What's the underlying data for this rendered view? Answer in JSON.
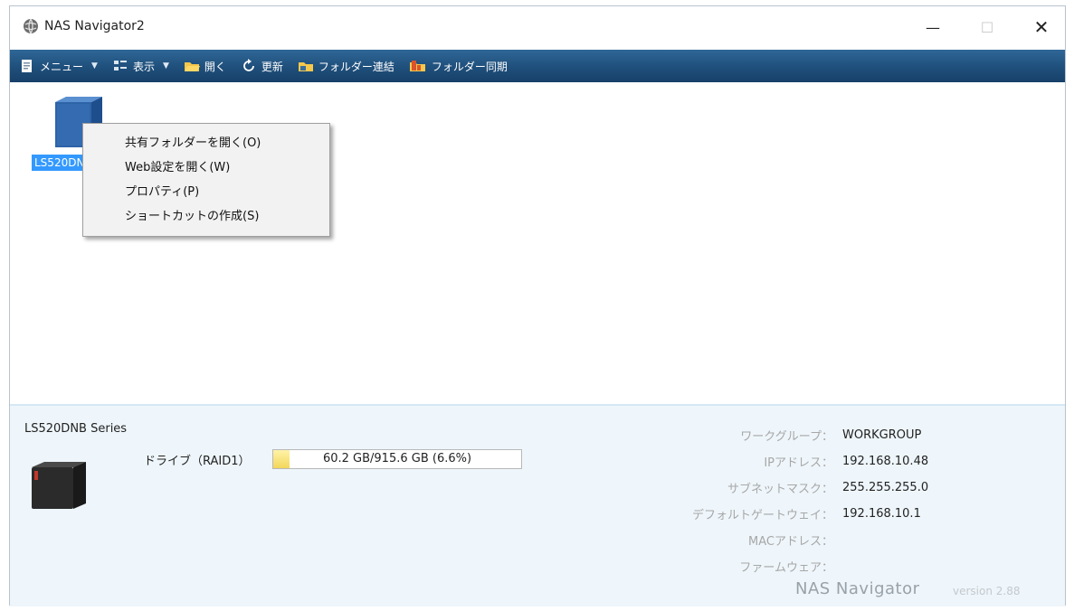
{
  "window": {
    "title": "NAS Navigator2",
    "minimize_glyph": "—",
    "maximize_glyph": "☐",
    "close_glyph": "✕"
  },
  "toolbar": {
    "items": [
      {
        "label": "メニュー",
        "icon": "menu-icon",
        "has_caret": true
      },
      {
        "label": "表示",
        "icon": "view-icon",
        "has_caret": true
      },
      {
        "label": "開く",
        "icon": "folder-open-icon",
        "has_caret": false
      },
      {
        "label": "更新",
        "icon": "refresh-icon",
        "has_caret": false
      },
      {
        "label": "フォルダー連結",
        "icon": "folder-link-icon",
        "has_caret": false
      },
      {
        "label": "フォルダー同期",
        "icon": "folder-sync-icon",
        "has_caret": false
      }
    ],
    "caret_glyph": "▼"
  },
  "device_area": {
    "device_label": "LS520DNB Series"
  },
  "context_menu": {
    "items": [
      {
        "label": "共有フォルダーを開く(O)"
      },
      {
        "label": "Web設定を開く(W)"
      },
      {
        "label": "プロパティ(P)"
      },
      {
        "label": "ショートカットの作成(S)"
      }
    ]
  },
  "info_panel": {
    "model_name": "LS520DNB Series",
    "drive_label": "ドライブ（RAID1）",
    "drive_usage_text": "60.2 GB/915.6 GB (6.6%)",
    "drive_usage_fraction": 0.066,
    "properties": [
      {
        "key": "ワークグループ：",
        "value": "WORKGROUP"
      },
      {
        "key": "IPアドレス：",
        "value": "192.168.10.48"
      },
      {
        "key": "サブネットマスク：",
        "value": "255.255.255.0"
      },
      {
        "key": "デフォルトゲートウェイ：",
        "value": "192.168.10.1"
      },
      {
        "key": "MACアドレス：",
        "value": ""
      },
      {
        "key": "ファームウェア：",
        "value": ""
      }
    ],
    "brand": "NAS Navigator",
    "version": "version 2.88"
  },
  "colors": {
    "toolbar": "#1f4f7b",
    "selection": "#3399ff",
    "info_panel_bg": "#eef6fb",
    "device_blue": "#2d64a8"
  }
}
